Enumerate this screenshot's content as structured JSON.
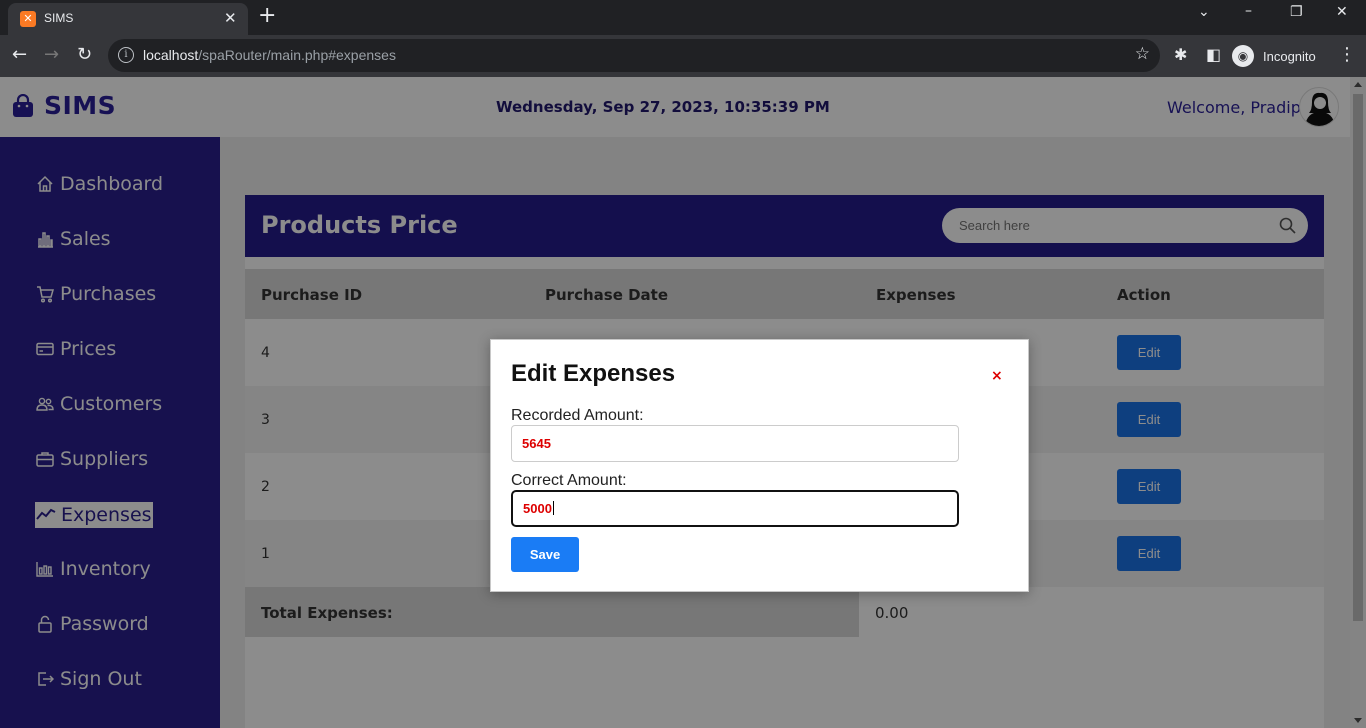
{
  "browser": {
    "tab_title": "SIMS",
    "tab_favicon": "xampp-icon",
    "url_host": "localhost",
    "url_path": "/spaRouter/main.php#expenses",
    "incognito_label": "Incognito"
  },
  "header": {
    "brand": "SIMS",
    "datetime": "Wednesday, Sep 27, 2023, 10:35:39 PM",
    "welcome": "Welcome, Pradip"
  },
  "sidebar": {
    "items": [
      {
        "label": "Dashboard",
        "icon": "home-icon"
      },
      {
        "label": "Sales",
        "icon": "bar-chart-icon"
      },
      {
        "label": "Purchases",
        "icon": "cart-icon"
      },
      {
        "label": "Prices",
        "icon": "card-icon"
      },
      {
        "label": "Customers",
        "icon": "people-icon"
      },
      {
        "label": "Suppliers",
        "icon": "briefcase-icon"
      },
      {
        "label": "Expenses",
        "icon": "trend-icon",
        "active": true
      },
      {
        "label": "Inventory",
        "icon": "columns-icon"
      },
      {
        "label": "Password",
        "icon": "lock-icon"
      },
      {
        "label": "Sign Out",
        "icon": "sign-out-icon"
      }
    ]
  },
  "main": {
    "title": "Products Price",
    "search_placeholder": "Search here",
    "columns": [
      "Purchase ID",
      "Purchase Date",
      "Expenses",
      "Action"
    ],
    "rows": [
      {
        "id": "4",
        "action": "Edit"
      },
      {
        "id": "3",
        "action": "Edit"
      },
      {
        "id": "2",
        "action": "Edit"
      },
      {
        "id": "1",
        "action": "Edit"
      }
    ],
    "total_label": "Total Expenses:",
    "total_value": "0.00"
  },
  "modal": {
    "title": "Edit Expenses",
    "close": "×",
    "recorded_label": "Recorded Amount:",
    "recorded_value": "5645",
    "correct_label": "Correct Amount:",
    "correct_value": "5000",
    "save_label": "Save"
  },
  "colors": {
    "sidebar": "#2a1f8f",
    "card_header": "#261d8d",
    "button": "#1a73e8",
    "value_text": "#dd0000"
  }
}
